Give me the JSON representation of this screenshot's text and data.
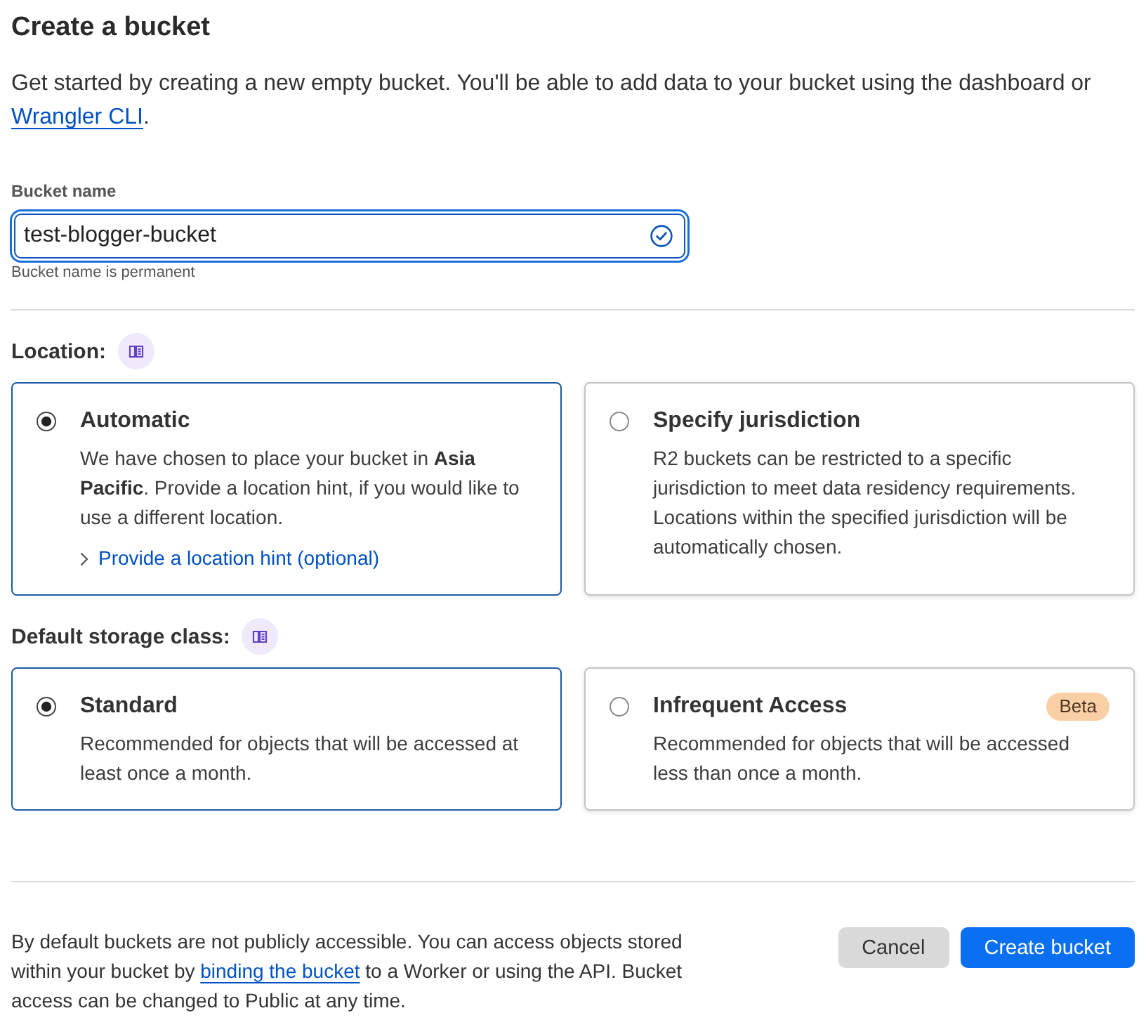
{
  "title": "Create a bucket",
  "intro": {
    "text_before": "Get started by creating a new empty bucket. You'll be able to add data to your bucket using the dashboard or ",
    "link": "Wrangler CLI",
    "text_after": "."
  },
  "bucket_name": {
    "label": "Bucket name",
    "value": "test-blogger-bucket",
    "focused": true,
    "valid": true,
    "helper": "Bucket name is permanent"
  },
  "sections": [
    {
      "heading": "Location:",
      "options": [
        {
          "title": "Automatic",
          "description": "We have chosen to place your bucket in **Asia Pacific**. Provide a location hint, if you would like to use a different location.",
          "selected": true,
          "link": "Provide a location hint (optional)"
        },
        {
          "title": "Specify jurisdiction",
          "description": "R2 buckets can be restricted to a specific jurisdiction to meet data residency requirements. Locations within the specified jurisdiction will be automatically chosen.",
          "selected": false
        }
      ]
    },
    {
      "heading": "Default storage class:",
      "options": [
        {
          "title": "Standard",
          "description": "Recommended for objects that will be accessed at least once a month.",
          "selected": true
        },
        {
          "title": "Infrequent Access",
          "description": "Recommended for objects that will be accessed less than once a month.",
          "selected": false,
          "badge": "Beta"
        }
      ]
    }
  ],
  "footer": {
    "text_before": "By default buckets are not publicly accessible. You can access objects stored within your bucket by ",
    "link": "binding the bucket",
    "text_after": " to a Worker or using the API. Bucket access can be changed to Public at any time."
  },
  "buttons": [
    {
      "label": "Cancel",
      "kind": "secondary"
    },
    {
      "label": "Create bucket",
      "kind": "primary"
    }
  ]
}
